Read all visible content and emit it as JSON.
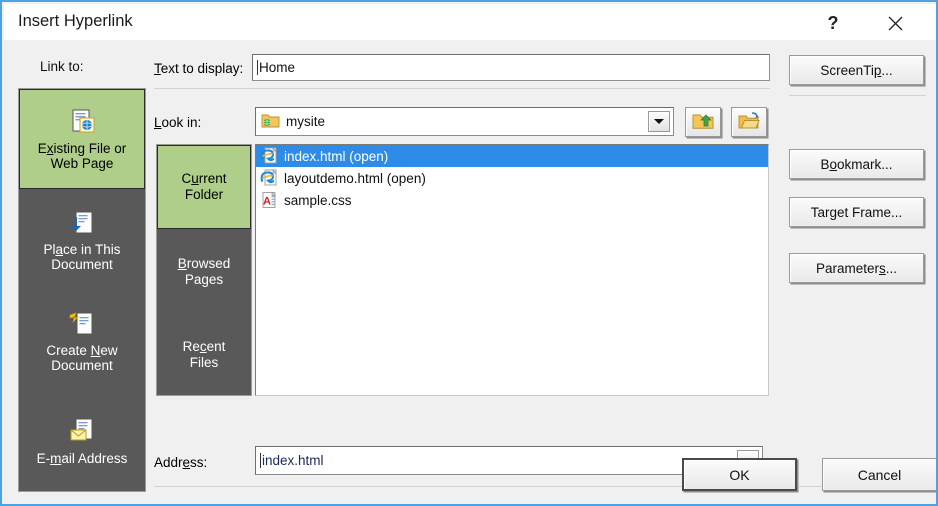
{
  "window": {
    "title": "Insert Hyperlink",
    "help_label": "?",
    "close_label": "✕",
    "accent_blue": "#4BA3E3",
    "selection_green": "#AFCE8A",
    "sidebar_gray": "#595959",
    "list_selection_blue": "#2D8CE8"
  },
  "link_to": {
    "label": "Link to:",
    "items": [
      {
        "label_before": "E",
        "label_accel": "x",
        "label_after": "isting File or Web Page",
        "plain": "Existing File or Web Page",
        "icon": "existing-file-web-page-icon",
        "selected": true
      },
      {
        "label_before": "Pl",
        "label_accel": "a",
        "label_after": "ce in This Document",
        "plain": "Place in This Document",
        "icon": "place-in-document-icon",
        "selected": false
      },
      {
        "label_before": "Create ",
        "label_accel": "N",
        "label_after": "ew Document",
        "plain": "Create New Document",
        "icon": "create-new-document-icon",
        "selected": false
      },
      {
        "label_before": "E-",
        "label_accel": "m",
        "label_after": "ail Address",
        "plain": "E-mail Address",
        "icon": "email-address-icon",
        "selected": false
      }
    ]
  },
  "text_to_display": {
    "label_before": "T",
    "label_accel": "",
    "label_plain": "Text to display:",
    "value": "Home"
  },
  "look_in": {
    "label_plain": "Look in:",
    "value": "mysite",
    "folder_icon": "folder-web-icon",
    "dropdown_icon": "chevron-down-icon",
    "up_button_icon": "up-one-level-folder-icon",
    "browse_button_icon": "browse-for-file-folder-icon"
  },
  "places": [
    {
      "line1": "Current",
      "line2": "Folder",
      "accel": "u",
      "selected": true
    },
    {
      "line1": "Browsed",
      "line2": "Pages",
      "accel": "B",
      "selected": false
    },
    {
      "line1": "Recent",
      "line2": "Files",
      "accel": "c",
      "selected": false
    }
  ],
  "files": [
    {
      "name": "index.html (open)",
      "icon": "internet-explorer-html-file-icon",
      "selected": true
    },
    {
      "name": "layoutdemo.html (open)",
      "icon": "internet-explorer-html-file-icon",
      "selected": false
    },
    {
      "name": "sample.css",
      "icon": "css-file-icon",
      "selected": false
    }
  ],
  "address": {
    "label_plain": "Address:",
    "value": "index.html",
    "dropdown_icon": "chevron-down-icon"
  },
  "side_buttons": [
    {
      "plain": "ScreenTip...",
      "before": "ScreenTi",
      "accel": "p",
      "after": "..."
    },
    {
      "plain": "Bookmark...",
      "before": "B",
      "accel": "o",
      "after": "okmark..."
    },
    {
      "plain": "Target Frame...",
      "before": "Tar",
      "accel": "g",
      "after": "et Frame..."
    },
    {
      "plain": "Parameters...",
      "before": "Parameter",
      "accel": "s",
      "after": "..."
    }
  ],
  "footer": {
    "ok_label": "OK",
    "cancel_label": "Cancel"
  }
}
